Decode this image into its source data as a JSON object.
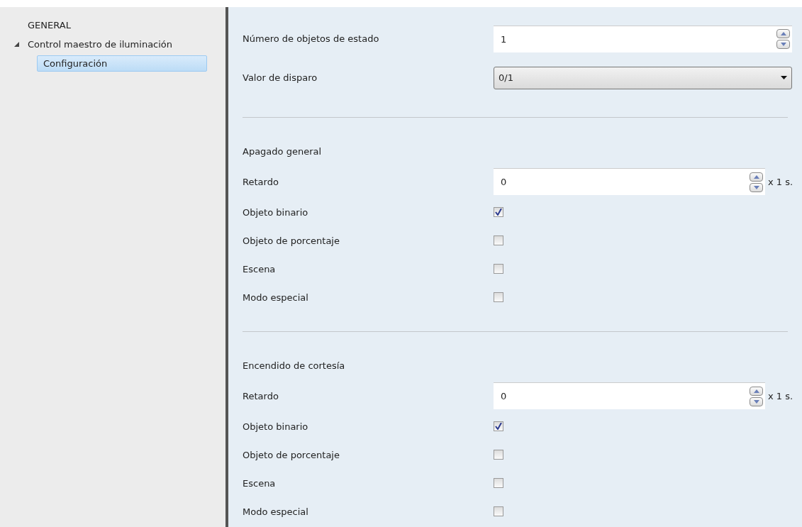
{
  "sidebar": {
    "items": [
      {
        "label": "GENERAL",
        "selected": false
      },
      {
        "label": "Control maestro de iluminación",
        "selected": false,
        "expanded": true,
        "children": [
          {
            "label": "Configuración",
            "selected": true
          }
        ]
      }
    ]
  },
  "panel": {
    "rows": [
      {
        "kind": "spin",
        "label": "Número de objetos de estado",
        "value": "1"
      },
      {
        "kind": "dropdown",
        "label": "Valor de disparo",
        "value": "0/1"
      },
      {
        "kind": "separator"
      },
      {
        "kind": "heading",
        "label": "Apagado general"
      },
      {
        "kind": "spin",
        "label": "Retardo",
        "value": "0",
        "unit": "x 1 s."
      },
      {
        "kind": "checkbox",
        "label": "Objeto binario",
        "checked": true
      },
      {
        "kind": "checkbox",
        "label": "Objeto de porcentaje",
        "checked": false
      },
      {
        "kind": "checkbox",
        "label": "Escena",
        "checked": false
      },
      {
        "kind": "checkbox",
        "label": "Modo especial",
        "checked": false
      },
      {
        "kind": "separator"
      },
      {
        "kind": "heading",
        "label": "Encendido de cortesía"
      },
      {
        "kind": "spin",
        "label": "Retardo",
        "value": "0",
        "unit": "x 1 s."
      },
      {
        "kind": "checkbox",
        "label": "Objeto binario",
        "checked": true
      },
      {
        "kind": "checkbox",
        "label": "Objeto de porcentaje",
        "checked": false
      },
      {
        "kind": "checkbox",
        "label": "Escena",
        "checked": false
      },
      {
        "kind": "checkbox",
        "label": "Modo especial",
        "checked": false
      }
    ]
  }
}
